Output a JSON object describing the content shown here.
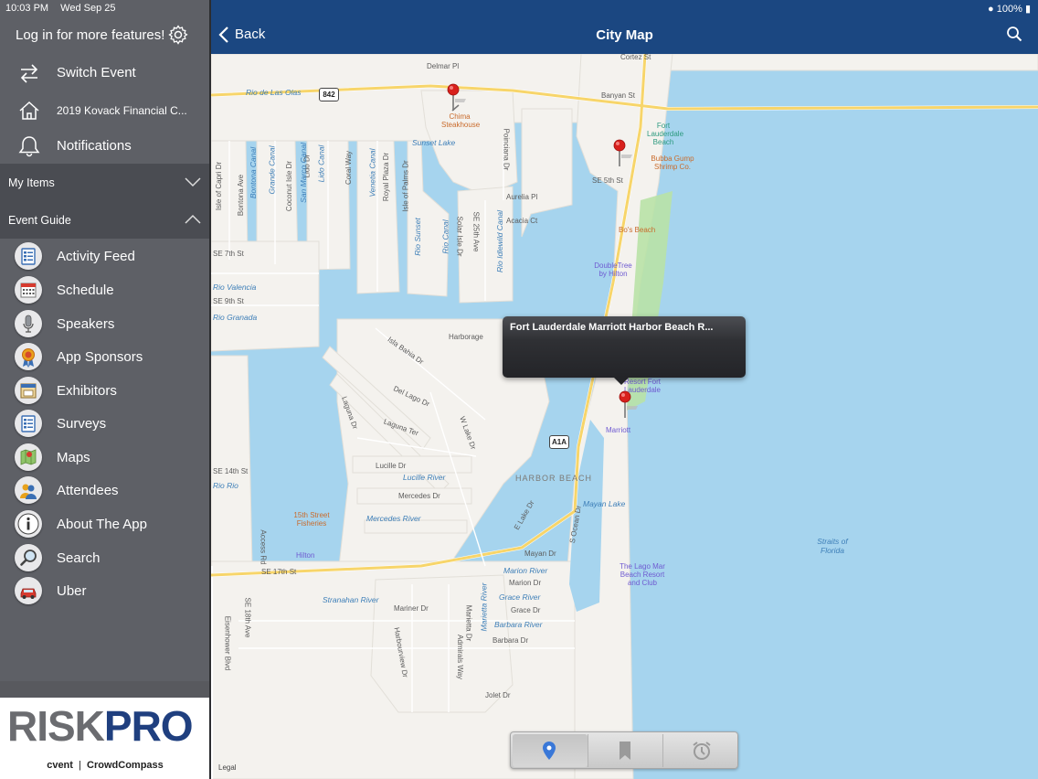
{
  "status": {
    "time": "10:03 PM",
    "date": "Wed Sep 25",
    "battery": "100%"
  },
  "sidebar": {
    "login_text": "Log in for more features!",
    "top_items": [
      {
        "label": "Switch Event",
        "icon": "switch-arrows-icon"
      },
      {
        "label": "2019 Kovack Financial C...",
        "icon": "home-icon"
      },
      {
        "label": "Notifications",
        "icon": "bell-icon"
      }
    ],
    "my_items_label": "My Items",
    "event_guide_label": "Event Guide",
    "guide_items": [
      {
        "label": "Activity Feed",
        "icon": "activity-feed-icon"
      },
      {
        "label": "Schedule",
        "icon": "calendar-icon"
      },
      {
        "label": "Speakers",
        "icon": "microphone-icon"
      },
      {
        "label": "App Sponsors",
        "icon": "ribbon-icon"
      },
      {
        "label": "Exhibitors",
        "icon": "exhibitor-booth-icon"
      },
      {
        "label": "Surveys",
        "icon": "survey-icon"
      },
      {
        "label": "Maps",
        "icon": "map-icon"
      },
      {
        "label": "Attendees",
        "icon": "attendees-icon"
      },
      {
        "label": "About The App",
        "icon": "info-icon"
      },
      {
        "label": "Search",
        "icon": "search-icon"
      },
      {
        "label": "Uber",
        "icon": "car-icon"
      }
    ],
    "logo_text": "RISKPRO",
    "logo_footer_left": "cvent",
    "logo_footer_right": "CrowdCompass"
  },
  "header": {
    "back_label": "Back",
    "title": "City Map"
  },
  "map": {
    "callout_text": "Fort Lauderdale Marriott Harbor Beach R...",
    "legal": "Legal",
    "shields": [
      "842",
      "A1A"
    ],
    "streets": [
      "Delmar Pl",
      "Cortez St",
      "Banyan St",
      "SE 5th St",
      "Aurelia Pl",
      "Acacia Ct",
      "SE 7th St",
      "SE 9th St",
      "SE 14th St",
      "SE 17th St",
      "Isla Bahia Dr",
      "Harborage",
      "Del Lago Dr",
      "Laguna Dr",
      "Laguna Ter",
      "Lucille Dr",
      "Mercedes Dr",
      "Mayan Dr",
      "Marion Dr",
      "Mariner Dr",
      "Grace Dr",
      "Barbara Dr",
      "Eisenhower Blvd",
      "SE 18th Ave",
      "Poinciana Dr",
      "Solar Isle Dr",
      "SE 25th Ave",
      "Access Rd",
      "Harbourview Dr",
      "Admirals Way",
      "Marietta Dr",
      "S Ocean Dr",
      "E Lake Dr",
      "W Lake Dr",
      "Isle of Capri Dr",
      "Bontona Ave",
      "Coconut Isle Dr",
      "Lido Dr",
      "Coral Way",
      "Royal Plaza Dr",
      "Isle of Palms Dr",
      "Jolet Dr"
    ],
    "waters": [
      "Rio de Las Olas",
      "Sunset Lake",
      "Rio Valencia",
      "Rio Granada",
      "Rio Sunset",
      "Rio Canal",
      "Rio Idlewild Canal",
      "Bontona Canal",
      "Grande Canal",
      "San Marco Canal",
      "Lido Canal",
      "Venetia Canal",
      "Lucille River",
      "Mercedes River",
      "Stranahan River",
      "Mayan Lake",
      "Marion River",
      "Grace River",
      "Barbara River",
      "Marietta River",
      "Straits of Florida",
      "Rio Rio"
    ],
    "pois": [
      "Chima Steakhouse",
      "Bubba Gump Shrimp Co.",
      "Bo's Beach",
      "15th Street Fisheries"
    ],
    "hotels": [
      "DoubleTree by Hilton",
      "Resort Fort Lauderdale",
      "Marriott",
      "Hilton",
      "The Lago Mar Beach Resort and Club"
    ],
    "beach": [
      "Fort Lauderdale Beach"
    ],
    "area": "HARBOR BEACH"
  },
  "tabbar": {
    "tabs": [
      "location-pin-icon",
      "bookmark-icon",
      "alarm-clock-icon"
    ]
  }
}
